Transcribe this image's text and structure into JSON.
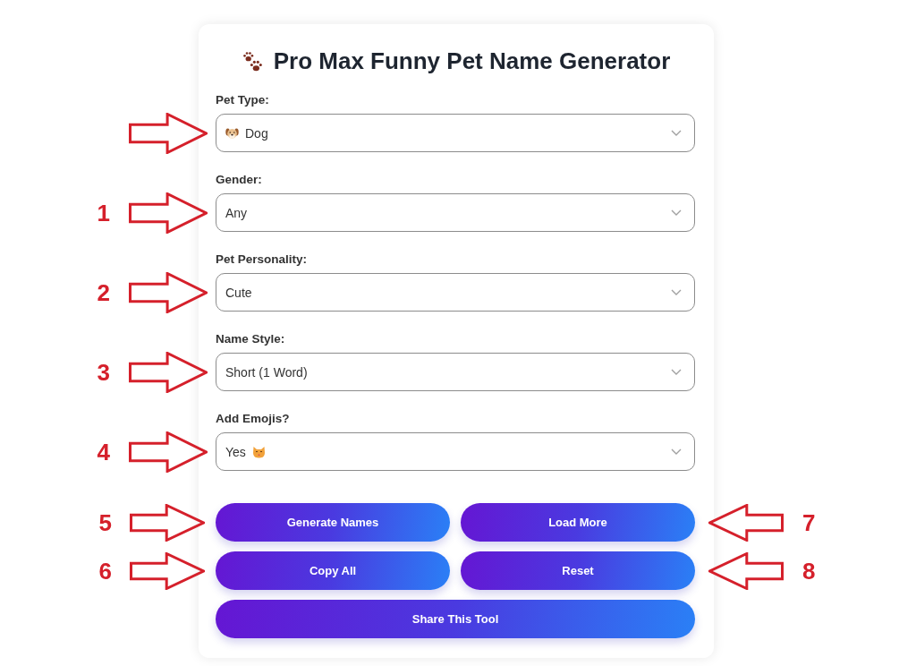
{
  "title": "Pro Max Funny Pet Name Generator",
  "fields": [
    {
      "label": "Pet Type:",
      "value": "Dog",
      "kind": "pet-select",
      "callout": {
        "kind": "rightward"
      }
    },
    {
      "label": "Gender:",
      "value": "Any",
      "kind": "select",
      "callout": {
        "kind": "rightward",
        "number": "1"
      }
    },
    {
      "label": "Pet Personality:",
      "value": "Cute",
      "kind": "select",
      "callout": {
        "kind": "rightward",
        "number": "2"
      }
    },
    {
      "label": "Name Style:",
      "value": "Short (1 Word)",
      "kind": "select",
      "callout": {
        "kind": "rightward",
        "number": "3"
      }
    },
    {
      "label": "Add Emojis?",
      "value": "Yes",
      "kind": "emoji-select",
      "callout": {
        "kind": "rightward",
        "number": "4"
      }
    }
  ],
  "button_rows": [
    [
      {
        "label": "Generate Names",
        "callout": {
          "kind": "rightward",
          "number": "5"
        }
      },
      {
        "label": "Load More",
        "callout": {
          "kind": "leftward",
          "number": "7"
        }
      }
    ],
    [
      {
        "label": "Copy All",
        "callout": {
          "kind": "rightward",
          "number": "6"
        }
      },
      {
        "label": "Reset",
        "callout": {
          "kind": "leftward",
          "number": "8"
        }
      }
    ],
    [
      {
        "label": "Share This Tool"
      }
    ]
  ]
}
